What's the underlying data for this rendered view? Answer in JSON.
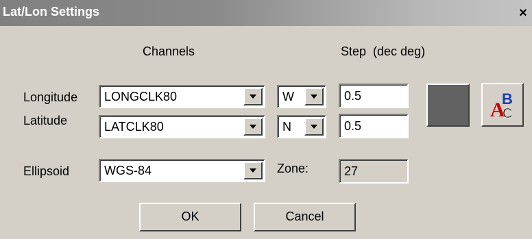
{
  "window": {
    "title": "Lat/Lon Settings",
    "close_glyph": "×"
  },
  "headers": {
    "channels": "Channels",
    "step": "Step  (dec deg)"
  },
  "longitude": {
    "label": "Longitude",
    "channel": "LONGCLK80",
    "hemisphere": "W",
    "step": "0.5"
  },
  "latitude": {
    "label": "Latitude",
    "channel": "LATCLK80",
    "hemisphere": "N",
    "step": "0.5"
  },
  "ellipsoid": {
    "label": "Ellipsoid",
    "value": "WGS-84"
  },
  "zone": {
    "label": "Zone:",
    "value": "27"
  },
  "buttons": {
    "ok": "OK",
    "cancel": "Cancel"
  },
  "colors": {
    "swatch": "#626262",
    "titlebar_start": "#808080"
  },
  "icons": {
    "dropdown": "chevron-down-icon",
    "font": "font-style-icon",
    "close": "close-icon"
  }
}
